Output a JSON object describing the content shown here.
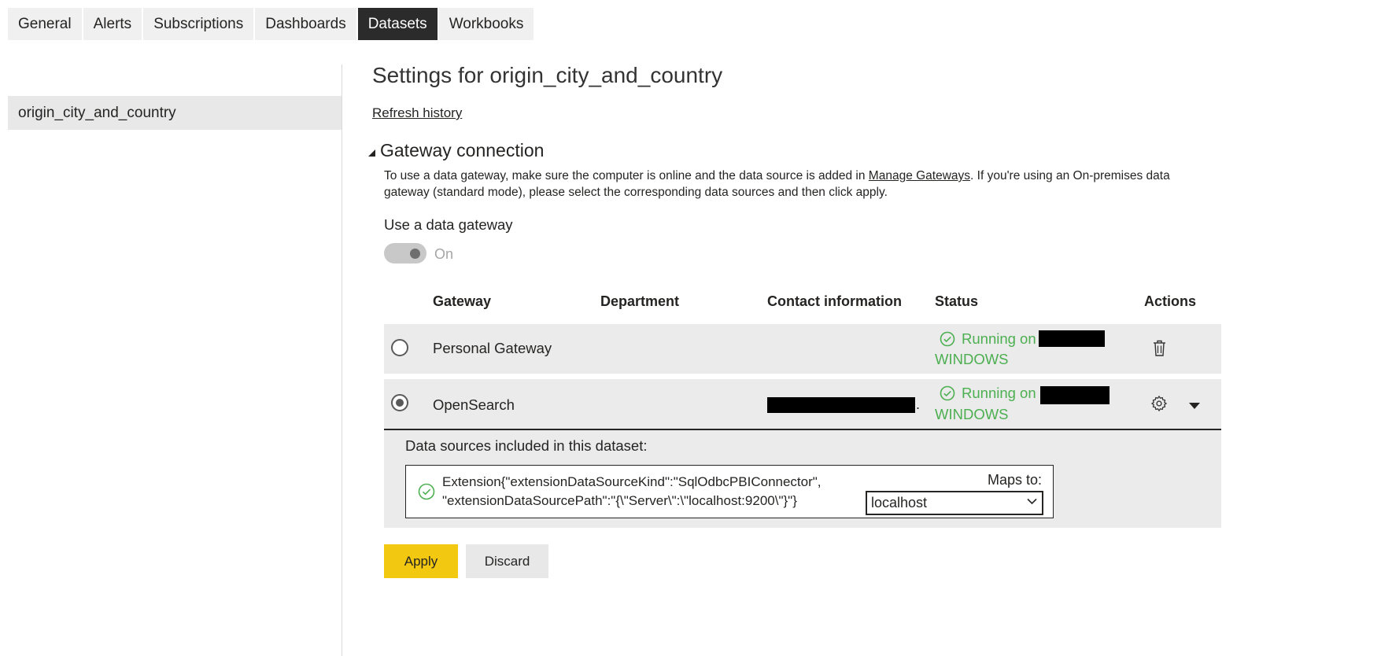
{
  "tabs": [
    {
      "label": "General"
    },
    {
      "label": "Alerts"
    },
    {
      "label": "Subscriptions"
    },
    {
      "label": "Dashboards"
    },
    {
      "label": "Datasets"
    },
    {
      "label": "Workbooks"
    }
  ],
  "active_tab": "Datasets",
  "sidebar": {
    "items": [
      {
        "label": "origin_city_and_country"
      }
    ]
  },
  "main": {
    "title": "Settings for origin_city_and_country",
    "refresh_link": "Refresh history",
    "gateway": {
      "section_title": "Gateway connection",
      "desc_pre": "To use a data gateway, make sure the computer is online and the data source is added in ",
      "desc_link": "Manage Gateways",
      "desc_post": ". If you're using an On-premises data gateway (standard mode), please select the corresponding data sources and then click apply.",
      "use_label": "Use a data gateway",
      "toggle_state": "On",
      "toggle_on": true,
      "columns": [
        "Gateway",
        "Department",
        "Contact information",
        "Status",
        "Actions"
      ],
      "rows": [
        {
          "name": "Personal Gateway",
          "selected": false,
          "status_line1": "Running on",
          "status_line2": "WINDOWS",
          "actions": [
            "trash-icon"
          ]
        },
        {
          "name": "OpenSearch",
          "selected": true,
          "contact_suffix": ".",
          "status_line1": "Running on",
          "status_line2": "WINDOWS",
          "actions": [
            "gear-icon",
            "chevron-down-icon"
          ]
        }
      ],
      "datasources_label": "Data sources included in this dataset:",
      "datasource": {
        "line1": "Extension{\"extensionDataSourceKind\":\"SqlOdbcPBIConnector\",",
        "line2": "\"extensionDataSourcePath\":\"{\\\"Server\\\":\\\"localhost:9200\\\"}\"}",
        "maps_label": "Maps to:",
        "maps_value": "localhost"
      }
    },
    "buttons": {
      "apply": "Apply",
      "discard": "Discard"
    }
  },
  "colors": {
    "accent": "#f2c811",
    "status_green": "#4caf50",
    "active_tab": "#2b2b2b"
  }
}
